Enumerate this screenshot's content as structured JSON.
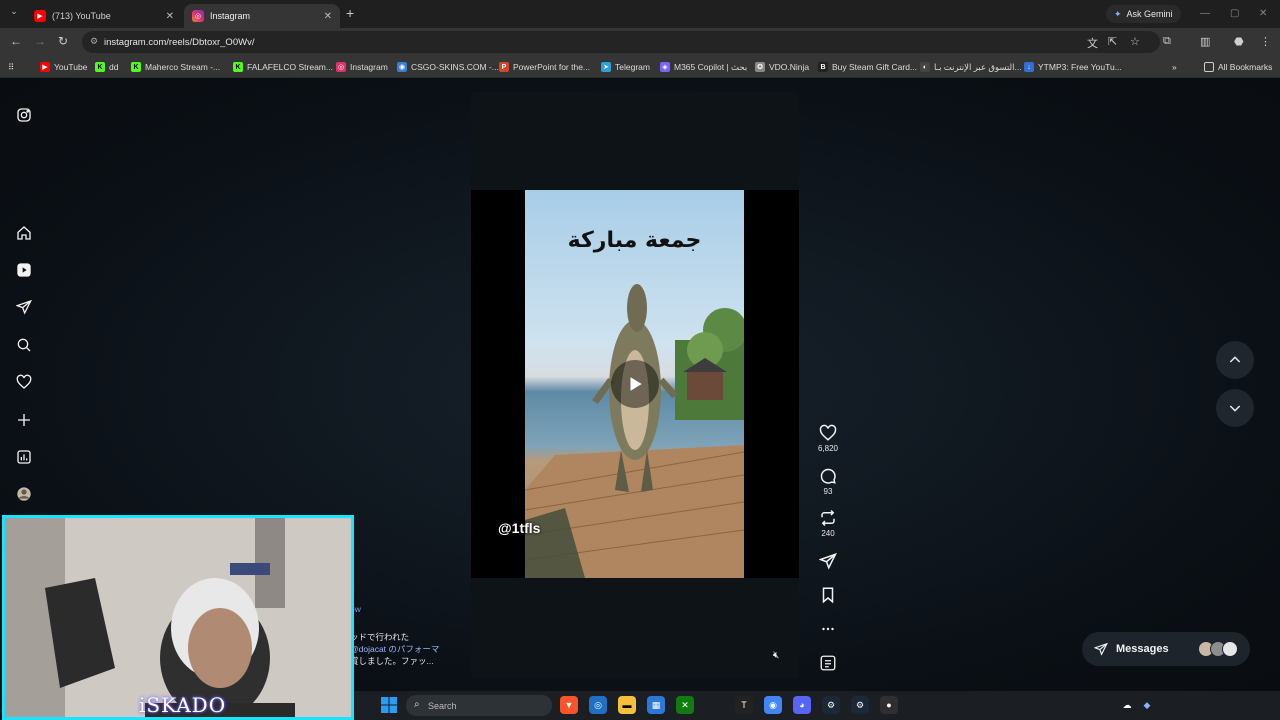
{
  "browser": {
    "tabs": [
      {
        "label": "(713) YouTube",
        "active": false,
        "color": "#ff0000"
      },
      {
        "label": "Instagram",
        "active": true,
        "color": "#e1306c"
      }
    ],
    "ask_gemini": "Ask Gemini",
    "url": "instagram.com/reels/Dbtoxr_O0Wv/",
    "bookmarks": [
      {
        "label": "YouTube",
        "icon": "youtube-icon",
        "color": "#ff0000",
        "glyph": "▶"
      },
      {
        "label": "dd",
        "icon": "kick-icon",
        "color": "#53fc18",
        "glyph": "K"
      },
      {
        "label": "Maherco Stream -...",
        "icon": "kick-icon",
        "color": "#53fc18",
        "glyph": "K"
      },
      {
        "label": "FALAFELCO Stream...",
        "icon": "kick-icon",
        "color": "#53fc18",
        "glyph": "K"
      },
      {
        "label": "Instagram",
        "icon": "instagram-icon",
        "color": "#e1306c",
        "glyph": "◎"
      },
      {
        "label": "CSGO-SKINS.COM -...",
        "icon": "csgo-icon",
        "color": "#3a7bd5",
        "glyph": "◉"
      },
      {
        "label": "PowerPoint for the...",
        "icon": "powerpoint-icon",
        "color": "#d24726",
        "glyph": "P"
      },
      {
        "label": "Telegram",
        "icon": "telegram-icon",
        "color": "#2aa1da",
        "glyph": "➤"
      },
      {
        "label": "M365 Copilot | بحث",
        "icon": "copilot-icon",
        "color": "#7b61ff",
        "glyph": "◈"
      },
      {
        "label": "VDO.Ninja",
        "icon": "vdoninja-icon",
        "color": "#888888",
        "glyph": "✪"
      },
      {
        "label": "Buy Steam Gift Card...",
        "icon": "bitrefill-icon",
        "color": "#222222",
        "glyph": "B"
      },
      {
        "label": "التسوق عبر الإنترنت بـا...",
        "icon": "shop-icon",
        "color": "#444444",
        "glyph": "◐"
      },
      {
        "label": "YTMP3: Free YouTu...",
        "icon": "download-icon",
        "color": "#2f6fd6",
        "glyph": "↓"
      }
    ],
    "all_bookmarks": "All Bookmarks"
  },
  "reel": {
    "overlay_text": "جمعة مباركة",
    "watermark": "@1tfls",
    "likes": "6,820",
    "comments": "93",
    "reposts": "240"
  },
  "background_caption": {
    "line0": "ow",
    "line1": "ッドで行われた",
    "line2": "@dojacat のパフォーマ",
    "line3": "賞しました。ファッ..."
  },
  "messages": {
    "label": "Messages"
  },
  "webcam": {
    "label": "iSKADO"
  },
  "taskbar": {
    "search_placeholder": "Search"
  }
}
